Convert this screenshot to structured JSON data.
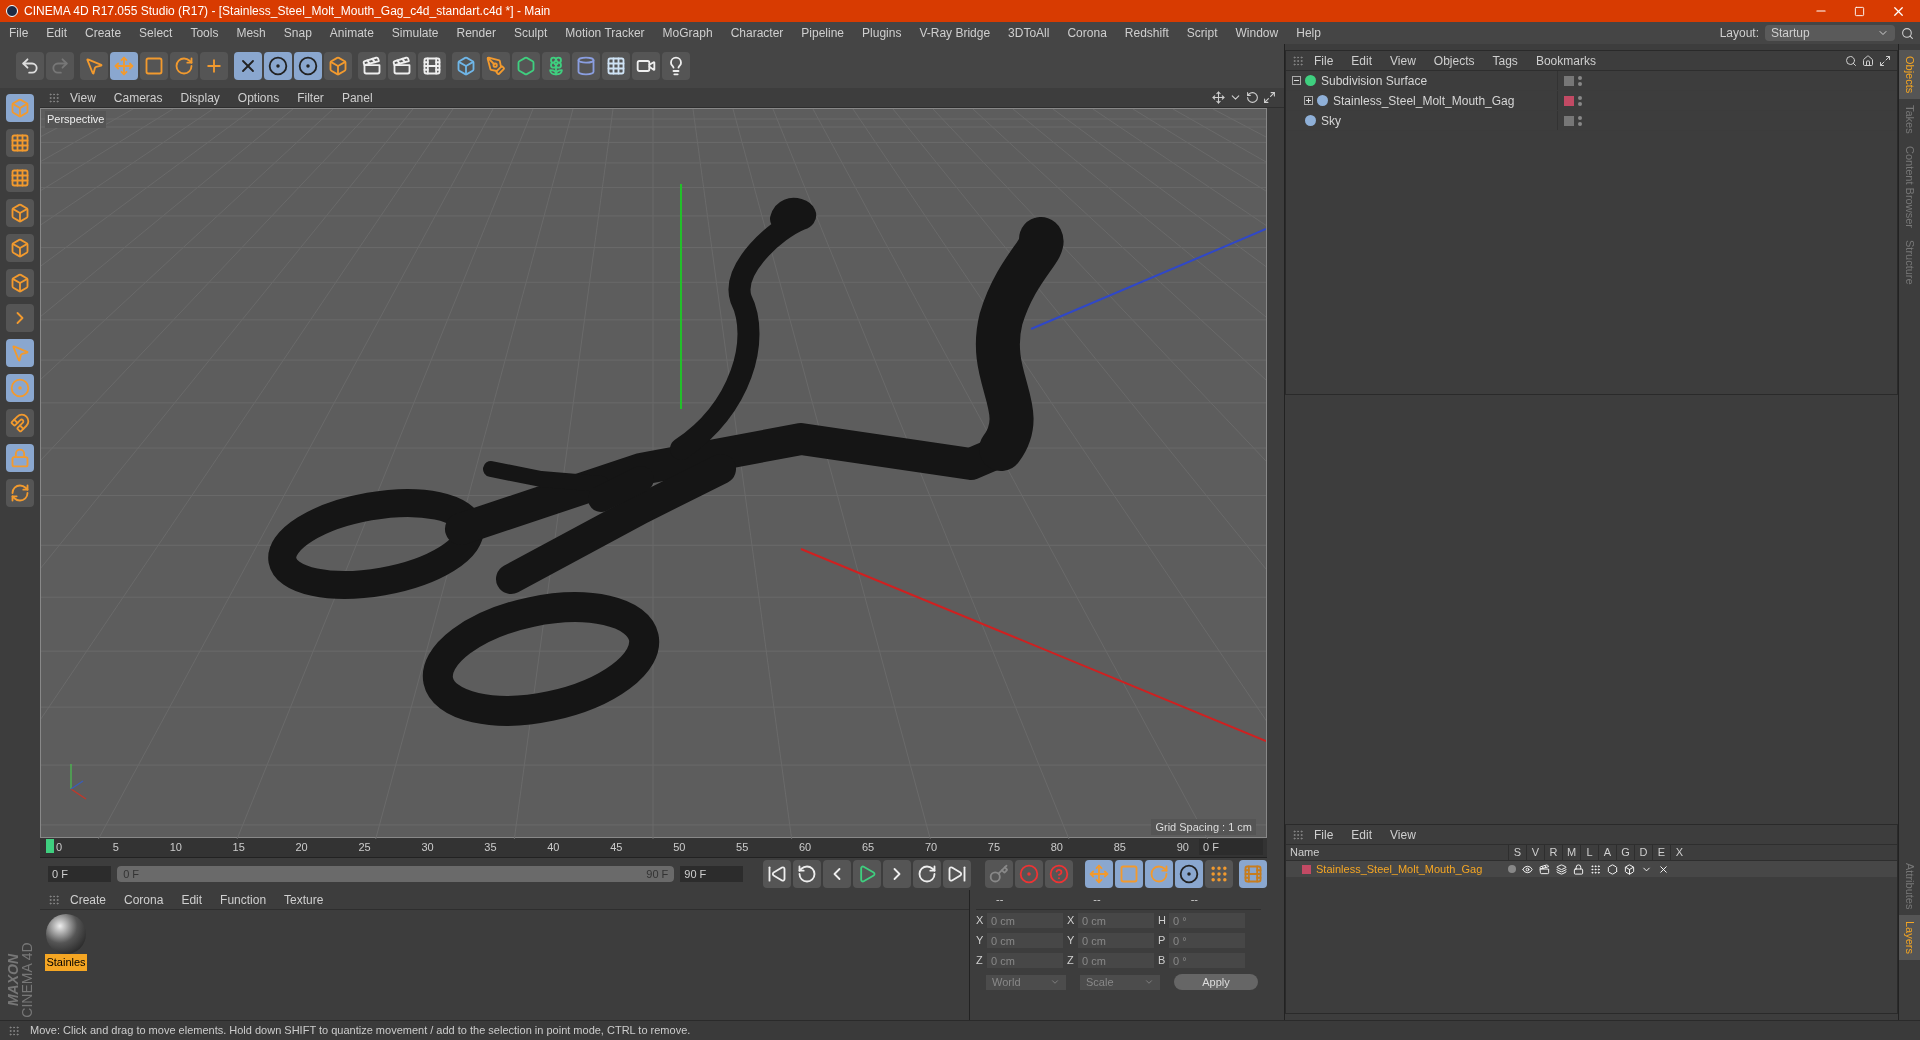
{
  "window": {
    "title": "CINEMA 4D R17.055 Studio (R17) - [Stainless_Steel_Molt_Mouth_Gag_c4d_standart.c4d *] - Main"
  },
  "menu": [
    "File",
    "Edit",
    "Create",
    "Select",
    "Tools",
    "Mesh",
    "Snap",
    "Animate",
    "Simulate",
    "Render",
    "Sculpt",
    "Motion Tracker",
    "MoGraph",
    "Character",
    "Pipeline",
    "Plugins",
    "V-Ray Bridge",
    "3DToAll",
    "Corona",
    "Redshift",
    "Script",
    "Window",
    "Help"
  ],
  "layout": {
    "label": "Layout:",
    "value": "Startup"
  },
  "viewport": {
    "menu": [
      "View",
      "Cameras",
      "Display",
      "Options",
      "Filter",
      "Panel"
    ],
    "camera": "Perspective",
    "grid_spacing": "Grid Spacing : 1 cm"
  },
  "objects_manager": {
    "menu": [
      "File",
      "Edit",
      "View",
      "Objects",
      "Tags",
      "Bookmarks"
    ],
    "tree": [
      {
        "name": "Subdivision Surface",
        "expanded": true,
        "children": [
          {
            "name": "Stainless_Steel_Molt_Mouth_Gag",
            "expanded": false,
            "color": "#c24a64"
          }
        ]
      },
      {
        "name": "Sky"
      }
    ]
  },
  "right_tabs_top": [
    {
      "label": "Objects",
      "selected": true
    },
    {
      "label": "Takes",
      "selected": false
    },
    {
      "label": "Content Browser",
      "selected": false
    },
    {
      "label": "Structure",
      "selected": false
    }
  ],
  "right_tabs_bottom": [
    {
      "label": "Attributes",
      "selected": false
    },
    {
      "label": "Layers",
      "selected": true
    }
  ],
  "timeline": {
    "ticks": [
      "0",
      "5",
      "10",
      "15",
      "20",
      "25",
      "30",
      "35",
      "40",
      "45",
      "50",
      "55",
      "60",
      "65",
      "70",
      "75",
      "80",
      "85",
      "90"
    ],
    "current": "0 F",
    "start": "0 F",
    "range_start": "0 F",
    "range_end": "90 F",
    "level": 1,
    "end": "90 F"
  },
  "materials": {
    "menu": [
      "Create",
      "Corona",
      "Edit",
      "Function",
      "Texture"
    ],
    "items": [
      {
        "name": "Stainles",
        "selected": true
      }
    ]
  },
  "coordinates": {
    "headers": [
      "--",
      "--",
      "--"
    ],
    "rows": [
      [
        {
          "label": "X",
          "value": "0 cm"
        },
        {
          "label": "X",
          "value": "0 cm"
        },
        {
          "label": "H",
          "value": "0 °"
        }
      ],
      [
        {
          "label": "Y",
          "value": "0 cm"
        },
        {
          "label": "Y",
          "value": "0 cm"
        },
        {
          "label": "P",
          "value": "0 °"
        }
      ],
      [
        {
          "label": "Z",
          "value": "0 cm"
        },
        {
          "label": "Z",
          "value": "0 cm"
        },
        {
          "label": "B",
          "value": "0 °"
        }
      ]
    ],
    "mode": "World",
    "transform": "Scale",
    "apply": "Apply"
  },
  "layers": {
    "menu": [
      "File",
      "Edit",
      "View"
    ],
    "columns": [
      "Name",
      "S",
      "V",
      "R",
      "M",
      "L",
      "A",
      "G",
      "D",
      "E",
      "X"
    ],
    "rows": [
      {
        "name": "Stainless_Steel_Molt_Mouth_Gag",
        "color": "#c24a64"
      }
    ]
  },
  "logo": {
    "brand": "MAXON",
    "product": "CINEMA 4D"
  },
  "status_bar": "Move: Click and drag to move elements. Hold down SHIFT to quantize movement / add to the selection in point mode, CTRL to remove."
}
